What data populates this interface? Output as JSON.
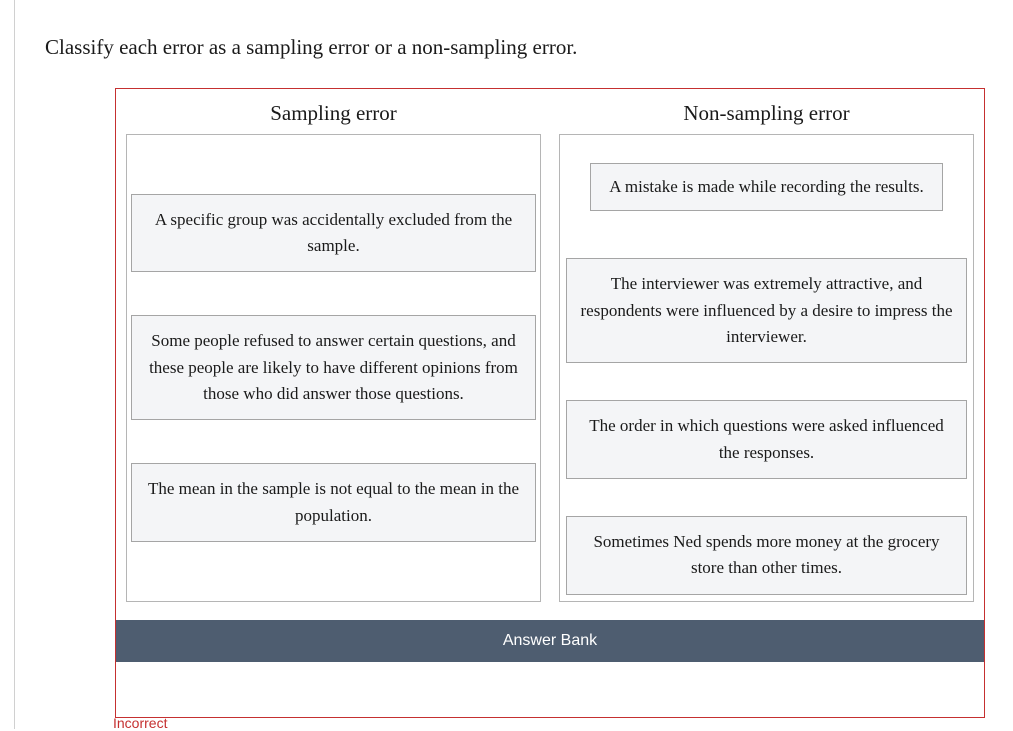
{
  "question": "Classify each error as a sampling error or a non-sampling error.",
  "columns": {
    "sampling": {
      "header": "Sampling error",
      "cards": [
        "A specific group was accidentally excluded from the sample.",
        "Some people refused to answer certain questions, and these people are likely to have different opinions from those who did answer those questions.",
        "The mean in the sample is not equal to the mean in the population."
      ]
    },
    "nonsampling": {
      "header": "Non-sampling error",
      "cards": [
        "A mistake is made while recording the results.",
        "The interviewer was extremely attractive, and respondents were influenced by a desire to impress the interviewer.",
        "The order in which questions were asked influenced the responses.",
        "Sometimes Ned spends more money at the grocery store than other times."
      ]
    }
  },
  "answer_bank": {
    "header": "Answer Bank"
  },
  "feedback": "Incorrect"
}
